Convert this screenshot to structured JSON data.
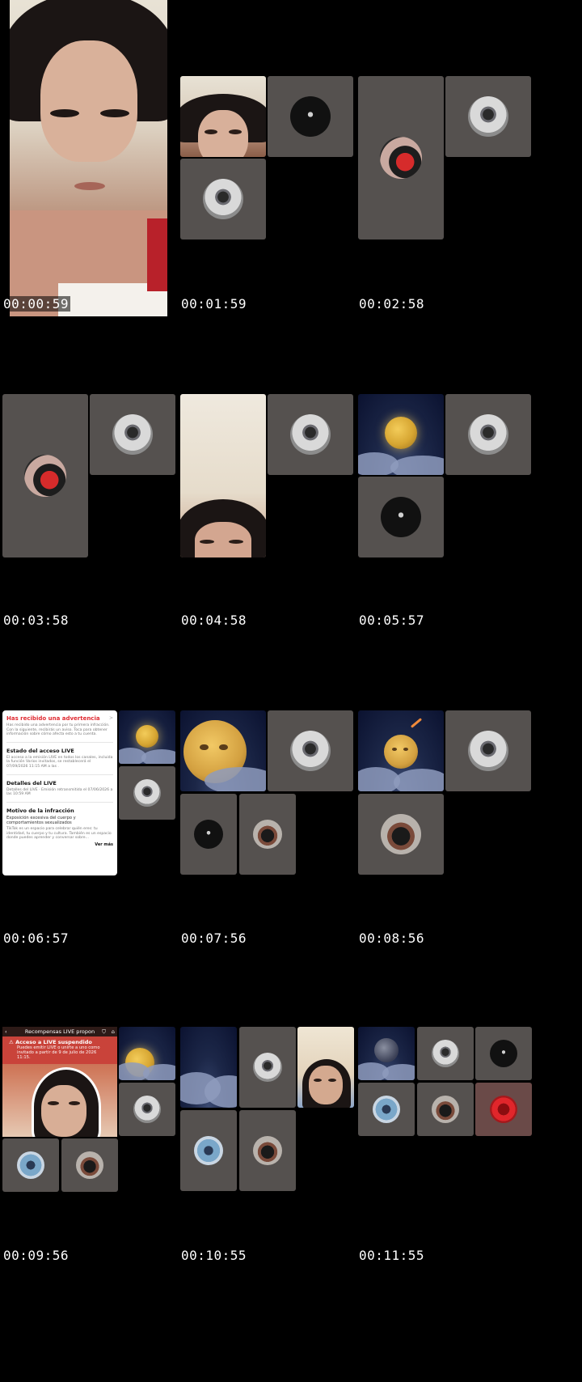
{
  "timestamps": [
    "00:00:59",
    "00:01:59",
    "00:02:58",
    "00:03:58",
    "00:04:58",
    "00:05:57",
    "00:06:57",
    "00:07:56",
    "00:08:56",
    "00:09:56",
    "00:10:55",
    "00:11:55"
  ],
  "warning_card": {
    "title": "Has recibido una advertencia",
    "chevron": ">",
    "intro": "Has recibido una advertencia por tu primera infracción. Con la siguiente, recibirás un aviso. Toca para obtener información sobre cómo afecta esto a tu cuenta.",
    "live_status_title": "Estado del acceso LIVE",
    "live_status_text": "El acceso a la emisión LIVE en todos los canales, incluida la función Varios invitados, se restablecerá el 07/09/2026 11:15 AM a las .",
    "live_details_title": "Detalles del LIVE",
    "live_details_text": "Detalles del LIVE · Emisión retransmitida el 07/06/2026 a las 10:59 AM",
    "reason_title": "Motivo de la infracción",
    "reason_main": "Exposición excesiva del cuerpo y comportamientos sexualizados",
    "reason_text": "TikTok es un espacio para celebrar quién eres: tu identidad, tu cuerpo y tu cultura. También es un espacio donde puedes aprender y conversar sobre...",
    "see_more": "Ver más"
  },
  "suspended_banner": {
    "top_title": "Recompensas LIVE propon",
    "alert_title": "Acceso a LIVE suspendido",
    "alert_text": "Puedes emitir LIVE o unirte a uno como invitado a partir de 9 de julio de 2026 11:15."
  },
  "colors": {
    "tile": "#55514f",
    "warning_red": "#e02b32",
    "banner_red": "#c9433a",
    "background": "#000000"
  }
}
